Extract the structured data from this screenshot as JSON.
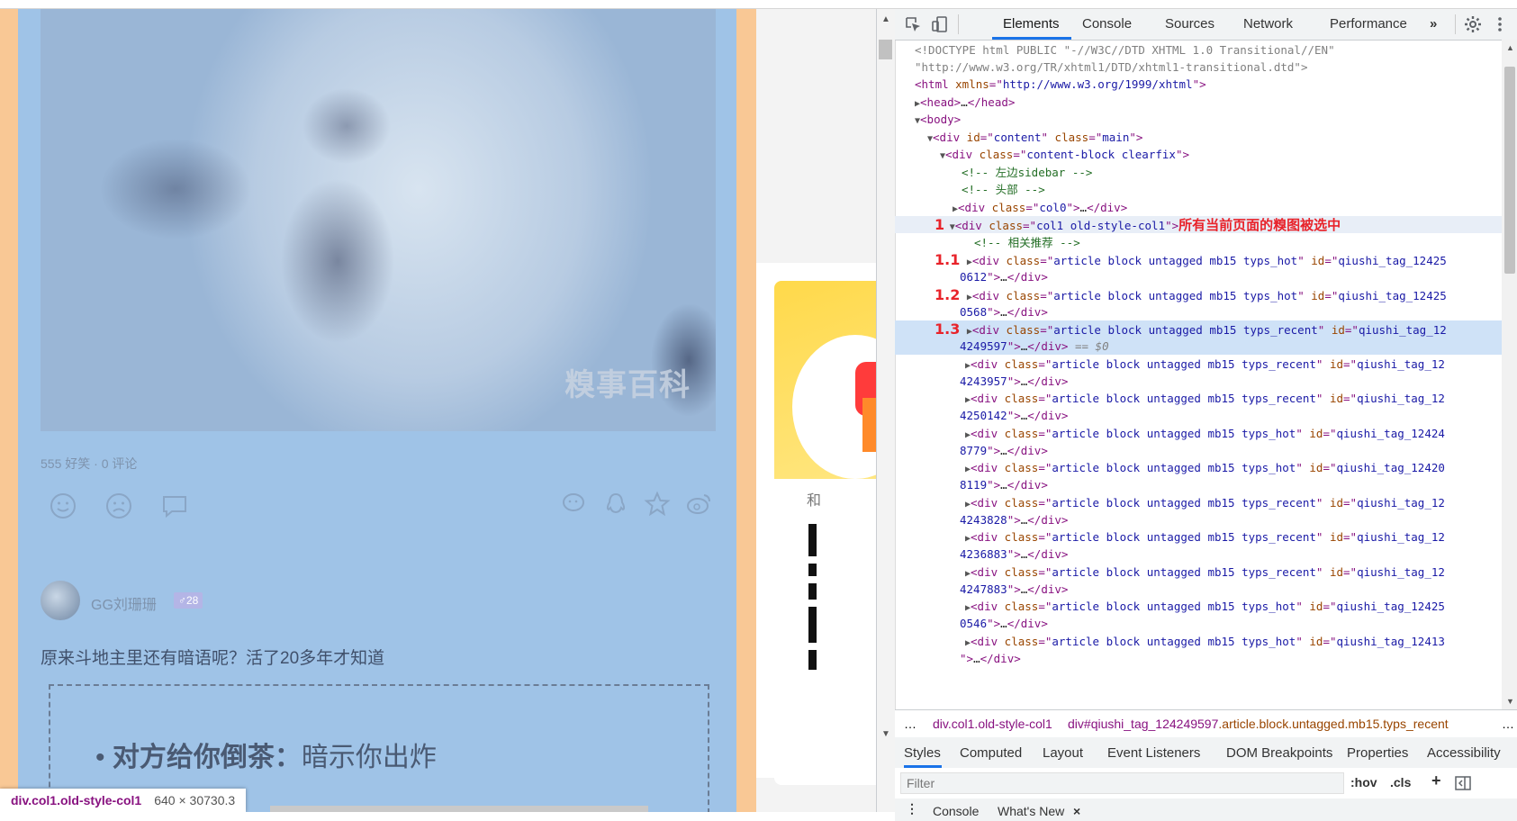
{
  "page": {
    "watermark": "糗事百科",
    "stats": "555 好笑 · 0 评论",
    "user": {
      "name": "GG刘珊珊",
      "badge": "♂28"
    },
    "post_title": "原来斗地主里还有暗语呢？活了20多年才知道",
    "bullet": {
      "bold": "对方给你倒茶：",
      "text": "暗示你出炸"
    },
    "side_char": "和",
    "tooltip": {
      "selector": "div.col1.old-style-col1",
      "size": "640 × 30730.3"
    }
  },
  "devtools": {
    "tabs": [
      "Elements",
      "Console",
      "Sources",
      "Network",
      "Performance"
    ],
    "more_tabs": "»",
    "tree": {
      "doctype1": "<!DOCTYPE html PUBLIC \"-//W3C//DTD XHTML 1.0 Transitional//EN\"",
      "doctype2": "\"http://www.w3.org/TR/xhtml1/DTD/xhtml1-transitional.dtd\">",
      "html_attr": "xmlns",
      "html_val": "http://www.w3.org/1999/xhtml",
      "comment_sidebar": "<!-- 左边sidebar -->",
      "comment_header": "<!-- 头部 -->",
      "comment_related": "<!-- 相关推荐 -->",
      "annotation_text": "所有当前页面的糗图被选中",
      "selected_suffix": " == $0",
      "articles": [
        {
          "label": "1.1",
          "type": "typs_hot",
          "id1": "qiushi_tag_12425",
          "id2": "0612"
        },
        {
          "label": "1.2",
          "type": "typs_hot",
          "id1": "qiushi_tag_12425",
          "id2": "0568"
        },
        {
          "label": "1.3",
          "type": "typs_recent",
          "id1": "qiushi_tag_12",
          "id2": "4249597"
        },
        {
          "label": "",
          "type": "typs_recent",
          "id1": "qiushi_tag_12",
          "id2": "4243957"
        },
        {
          "label": "",
          "type": "typs_recent",
          "id1": "qiushi_tag_12",
          "id2": "4250142"
        },
        {
          "label": "",
          "type": "typs_hot",
          "id1": "qiushi_tag_12424",
          "id2": "8779"
        },
        {
          "label": "",
          "type": "typs_hot",
          "id1": "qiushi_tag_12420",
          "id2": "8119"
        },
        {
          "label": "",
          "type": "typs_recent",
          "id1": "qiushi_tag_12",
          "id2": "4243828"
        },
        {
          "label": "",
          "type": "typs_recent",
          "id1": "qiushi_tag_12",
          "id2": "4236883"
        },
        {
          "label": "",
          "type": "typs_recent",
          "id1": "qiushi_tag_12",
          "id2": "4247883"
        },
        {
          "label": "",
          "type": "typs_hot",
          "id1": "qiushi_tag_12425",
          "id2": "0546"
        },
        {
          "label": "",
          "type": "typs_hot",
          "id1": "qiushi_tag_12413",
          "id2": ""
        }
      ]
    },
    "breadcrumb": {
      "more": "…",
      "first": "div.col1.old-style-col1",
      "second_tag": "div",
      "second_id": "#qiushi_tag_124249597",
      "second_cls": ".article.block.untagged.mb15.typs_recent",
      "tail": "…"
    },
    "subtabs": [
      "Styles",
      "Computed",
      "Layout",
      "Event Listeners",
      "DOM Breakpoints",
      "Properties",
      "Accessibility"
    ],
    "filter_placeholder": "Filter",
    "hov": ":hov",
    "cls": ".cls",
    "drawer_tabs": [
      "Console",
      "What's New"
    ]
  }
}
